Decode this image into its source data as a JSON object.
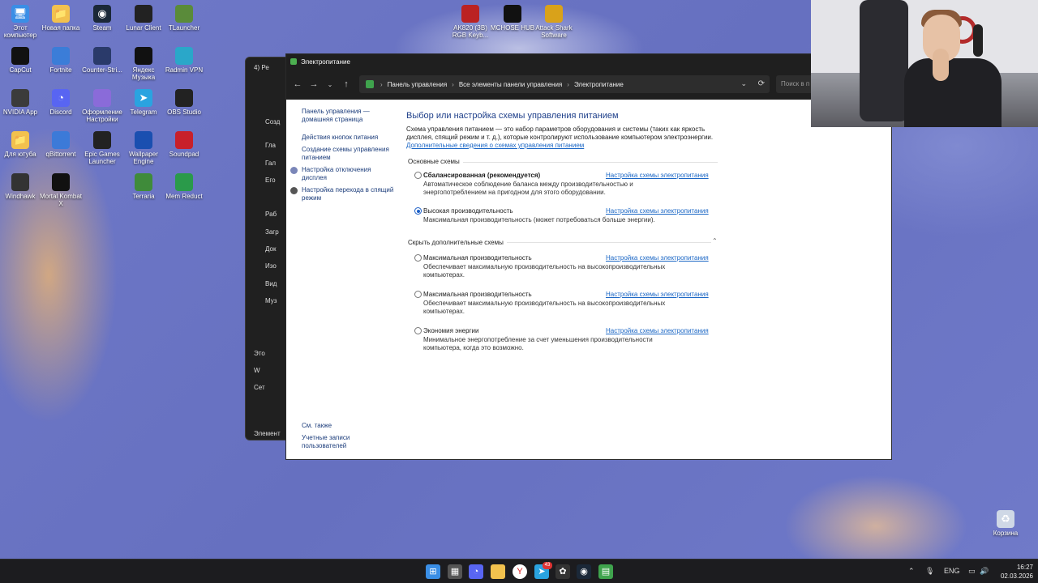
{
  "desktop": {
    "icons": [
      {
        "label": "Этот компьютер",
        "icon": "computer-icon",
        "color": "#3a8ee6"
      },
      {
        "label": "Новая папка",
        "icon": "folder-icon",
        "color": "#f2c14e"
      },
      {
        "label": "Steam",
        "icon": "steam-icon",
        "color": "#1b2838"
      },
      {
        "label": "Lunar Client",
        "icon": "lunar-client-icon",
        "color": "#222"
      },
      {
        "label": "TLauncher",
        "icon": "tlauncher-icon",
        "color": "#5a8b3a"
      },
      {
        "label": "CapCut",
        "icon": "capcut-icon",
        "color": "#111"
      },
      {
        "label": "Fortnite",
        "icon": "fortnite-icon",
        "color": "#3b7dd8"
      },
      {
        "label": "Counter-Stri...",
        "icon": "counter-strike-icon",
        "color": "#2a3a6a"
      },
      {
        "label": "Яндекс Музыка",
        "icon": "yandex-music-icon",
        "color": "#111"
      },
      {
        "label": "Radmin VPN",
        "icon": "radmin-vpn-icon",
        "color": "#2aa7c9"
      },
      {
        "label": "NVIDIA App",
        "icon": "nvidia-icon",
        "color": "#3b3b3b"
      },
      {
        "label": "Discord",
        "icon": "discord-icon",
        "color": "#5865f2"
      },
      {
        "label": "Оформление Настройки",
        "icon": "settings-folder-icon",
        "color": "#8a6bd9"
      },
      {
        "label": "Telegram",
        "icon": "telegram-icon",
        "color": "#2aa3e0"
      },
      {
        "label": "OBS Studio",
        "icon": "obs-icon",
        "color": "#222"
      },
      {
        "label": "Для ютуба",
        "icon": "folder-icon",
        "color": "#f2c14e"
      },
      {
        "label": "qBittorrent",
        "icon": "qbittorrent-icon",
        "color": "#3c7ad8"
      },
      {
        "label": "Epic Games Launcher",
        "icon": "epic-games-icon",
        "color": "#222"
      },
      {
        "label": "Wallpaper Engine",
        "icon": "wallpaper-engine-icon",
        "color": "#1a4fb0"
      },
      {
        "label": "Soundpad",
        "icon": "soundpad-icon",
        "color": "#c8202a"
      },
      {
        "label": "Windhawk",
        "icon": "windhawk-icon",
        "color": "#333"
      },
      {
        "label": "Mortal Kombat X",
        "icon": "mortal-kombat-icon",
        "color": "#111"
      },
      {
        "label": "Terraria",
        "icon": "terraria-icon",
        "color": "#3f8b3a"
      },
      {
        "label": "Mem Reduct",
        "icon": "mem-reduct-icon",
        "color": "#2a9a4a"
      },
      {
        "label": "AK820 (ЗВ) RGB Keyb...",
        "icon": "keyboard-app-icon",
        "color": "#b22"
      },
      {
        "label": "MCHOSE HUB",
        "icon": "mchose-icon",
        "color": "#111"
      },
      {
        "label": "Attack Shark Software",
        "icon": "attack-shark-icon",
        "color": "#d9a21a"
      },
      {
        "label": "Корзина",
        "icon": "recycle-bin-icon",
        "color": "#cfd8e6"
      }
    ]
  },
  "explorer": {
    "title": "4) Ре",
    "items": [
      "Созд",
      "Гла",
      "Гал",
      "Его",
      "Раб",
      "Загр",
      "Док",
      "Изо",
      "Вид",
      "Муз",
      "Это",
      "W",
      "Сет"
    ],
    "status": "Элемент"
  },
  "window": {
    "title": "Электропитание",
    "breadcrumb": [
      "Панель управления",
      "Все элементы панели управления",
      "Электропитание"
    ],
    "search_placeholder": "Поиск в п"
  },
  "sidebar": {
    "home_link": "Панель управления — домашняя страница",
    "links": [
      "Действия кнопок питания",
      "Создание схемы управления питанием",
      "Настройка отключения дисплея",
      "Настройка перехода в спящий режим"
    ],
    "see_also": "См. также",
    "user_accounts": "Учетные записи пользователей"
  },
  "main": {
    "heading": "Выбор или настройка схемы управления питанием",
    "description": "Схема управления питанием — это набор параметров оборудования и системы (таких как яркость дисплея, спящий режим и т. д.), которые контролируют использование компьютером электроэнергии.",
    "more_link": "Дополнительные сведения о схемах управления питанием",
    "basic_header": "Основные схемы",
    "hidden_header": "Скрыть дополнительные схемы",
    "configure_label": "Настройка схемы электропитания",
    "basic_plans": [
      {
        "name": "Сбалансированная (рекомендуется)",
        "selected": false,
        "bold": true,
        "desc": "Автоматическое соблюдение баланса между производительностью и энергопотреблением на пригодном для этого оборудовании."
      },
      {
        "name": "Высокая производительность",
        "selected": true,
        "bold": false,
        "desc": "Максимальная производительность (может потребоваться больше энергии)."
      }
    ],
    "extra_plans": [
      {
        "name": "Максимальная производительность",
        "selected": false,
        "desc": "Обеспечивает максимальную производительность на высокопроизводительных компьютерах."
      },
      {
        "name": "Максимальная производительность",
        "selected": false,
        "desc": "Обеспечивает максимальную производительность на высокопроизводительных компьютерах."
      },
      {
        "name": "Экономия энергии",
        "selected": false,
        "desc": "Минимальное энергопотребление за счет уменьшения производительности компьютера, когда это возможно."
      }
    ]
  },
  "taskbar": {
    "language": "ENG",
    "time": "16:27",
    "date": "02.03.2026",
    "apps": [
      "start-icon",
      "calculator-icon",
      "discord-icon",
      "file-explorer-icon",
      "yandex-browser-icon",
      "telegram-icon",
      "chatgpt-icon",
      "steam-icon",
      "control-panel-icon"
    ],
    "badge": "43"
  }
}
